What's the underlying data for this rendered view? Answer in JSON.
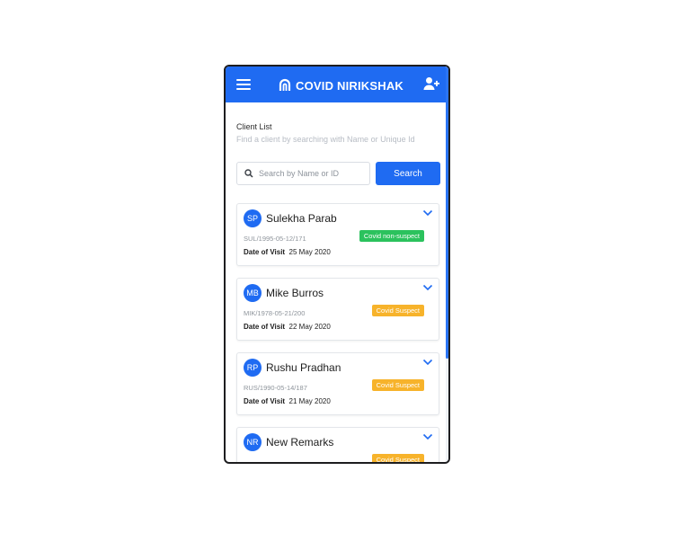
{
  "app": {
    "brand_name": "COVID NIRIKSHAK",
    "accent_color": "#1f6bf2",
    "icons": {
      "menu": "hamburger-icon",
      "brand": "covid-logo-icon",
      "add_user": "add-user-icon",
      "search": "search-icon",
      "expand": "chevron-down-icon"
    }
  },
  "list": {
    "title": "Client List",
    "subtitle": "Find a client by searching with Name or Unique Id"
  },
  "search": {
    "placeholder": "Search by Name or ID",
    "value": "",
    "button_label": "Search"
  },
  "clients": [
    {
      "initials": "SP",
      "name": "Sulekha Parab",
      "uid": "SUL/1995-05-12/171",
      "status": "Covid non-suspect",
      "status_color": "#2bc25d",
      "visit_label": "Date of Visit",
      "visit_date": "25 May 2020"
    },
    {
      "initials": "MB",
      "name": "Mike Burros",
      "uid": "MIK/1978-05-21/200",
      "status": "Covid Suspect",
      "status_color": "#f7b32b",
      "visit_label": "Date of Visit",
      "visit_date": "22 May 2020"
    },
    {
      "initials": "RP",
      "name": "Rushu Pradhan",
      "uid": "RUS/1990-05-14/187",
      "status": "Covid Suspect",
      "status_color": "#f7b32b",
      "visit_label": "Date of Visit",
      "visit_date": "21 May 2020"
    },
    {
      "initials": "NR",
      "name": "New Remarks",
      "uid": "",
      "status": "Covid Suspect",
      "status_color": "#f7b32b",
      "visit_label": "",
      "visit_date": ""
    }
  ]
}
